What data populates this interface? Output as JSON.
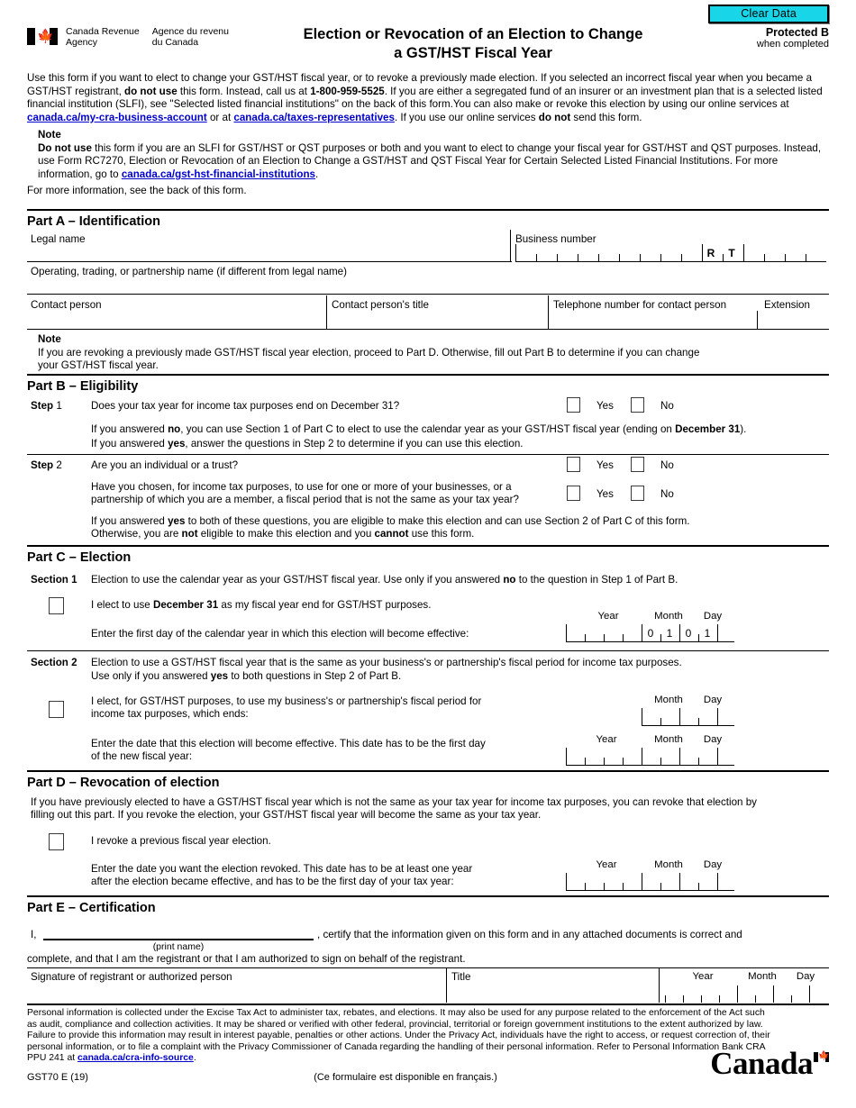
{
  "toolbar": {
    "clear_data_label": "Clear Data"
  },
  "header": {
    "agency_en": "Canada Revenue\nAgency",
    "agency_en_l1": "Canada Revenue",
    "agency_en_l2": "Agency",
    "agency_fr_l1": "Agence du revenu",
    "agency_fr_l2": "du Canada",
    "title_line1": "Election or Revocation of an Election to Change",
    "title_line2": "a GST/HST Fiscal Year",
    "protected_label": "Protected B",
    "protected_sub": "when completed"
  },
  "intro": {
    "p1_a": "Use this form if you want to elect to change your GST/HST fiscal year, or to revoke a previously made election. If you selected an incorrect fiscal year when you became a GST/HST registrant, ",
    "p1_b": "do not use",
    "p1_c": " this form. Instead, call us at ",
    "p1_d": "1-800-959-5525",
    "p1_e": ". If you are either a segregated fund of an insurer or an investment plan that is a selected listed financial institution (SLFI), see \"Selected listed financial institutions\" on the back of this form.You can also make or revoke this election by using our online services at ",
    "p1_link1": "canada.ca/my-cra-business-account",
    "p1_f": " or at ",
    "p1_link2": "canada.ca/taxes-representatives",
    "p1_g": ". If you use our online services ",
    "p1_h": "do not",
    "p1_i": " send this form."
  },
  "note1": {
    "label": "Note",
    "a": "Do not use",
    "b": " this form if you are an SLFI for GST/HST or QST purposes or both and you want to elect to change your fiscal year for GST/HST and QST purposes. Instead, use Form RC7270, Election or Revocation of an Election to Change a GST/HST and QST Fiscal Year for Certain Selected Listed Financial Institutions. For more information, go to ",
    "link": "canada.ca/gst-hst-financial-institutions",
    "c": ".",
    "more_info": "For more information, see the back of this form."
  },
  "partA": {
    "heading": "Part A – Identification",
    "legal_name_label": "Legal name",
    "business_number_label": "Business number",
    "bn_program_r": "R",
    "bn_program_t": "T",
    "operating_name_label": "Operating, trading, or partnership name (if different from legal name)",
    "contact_person_label": "Contact person",
    "contact_title_label": "Contact person's title",
    "telephone_label": "Telephone number for contact person",
    "extension_label": "Extension",
    "legal_name_value": "",
    "operating_name_value": "",
    "contact_person_value": "",
    "contact_title_value": "",
    "telephone_value": "",
    "extension_value": ""
  },
  "note2": {
    "label": "Note",
    "line1": "If you are revoking a previously made GST/HST fiscal year election, proceed to Part D. Otherwise, fill out Part B to determine if you can change",
    "line2": "your GST/HST fiscal year."
  },
  "partB": {
    "heading": "Part B – Eligibility",
    "step1_label_bold": "Step",
    "step1_label_num": " 1",
    "step1_question": "Does your tax year for income tax purposes end on December 31?",
    "yes_label": "Yes",
    "no_label": "No",
    "step1_note_a": "If you answered ",
    "step1_note_b": "no",
    "step1_note_c": ", you can use Section 1 of Part C to elect to use the calendar year as your GST/HST fiscal year (ending on ",
    "step1_note_d": "December 31",
    "step1_note_e": ").",
    "step1_note2_a": "If you answered ",
    "step1_note2_b": "yes",
    "step1_note2_c": ", answer the questions in Step 2 to determine if you can use this election.",
    "step2_label_bold": "Step",
    "step2_label_num": " 2",
    "step2_q1": "Are you an individual or a trust?",
    "step2_q2_line1": "Have you chosen, for income tax purposes, to use for one or more of your businesses, or a",
    "step2_q2_line2": "partnership of which you are a member, a fiscal period that is not the same as your tax year?",
    "step2_note_a": "If you answered ",
    "step2_note_b": "yes",
    "step2_note_c": " to both of these questions, you are eligible to make this election and can use Section 2 of Part C of this form.",
    "step2_note2_a": "Otherwise, you are ",
    "step2_note2_b": "not",
    "step2_note2_c": " eligible to make this election and you ",
    "step2_note2_d": "cannot",
    "step2_note2_e": " use this form."
  },
  "partC": {
    "heading": "Part C – Election",
    "section1_label": "Section 1",
    "section1_desc_a": "Election to use the calendar year as your GST/HST fiscal year. Use only if you answered ",
    "section1_desc_b": "no",
    "section1_desc_c": " to the question in Step 1 of Part B.",
    "section1_elect_a": "I elect to use ",
    "section1_elect_b": "December 31",
    "section1_elect_c": " as my fiscal year end for GST/HST purposes.",
    "section1_date_prompt": "Enter the first day of the calendar year in which this election will become effective:",
    "section2_label": "Section 2",
    "section2_desc_line1": "Election to use a GST/HST fiscal year that is the same as your business's or partnership's fiscal period for income tax purposes.",
    "section2_desc_line2_a": "Use only if you answered ",
    "section2_desc_line2_b": "yes",
    "section2_desc_line2_c": " to both questions in Step 2 of Part B.",
    "section2_elect_line1": "I elect, for GST/HST purposes, to use my business's or partnership's fiscal period for",
    "section2_elect_line2": "income tax purposes, which ends:",
    "section2_date_line1": "Enter the date that this election will become effective. This date has to be the first day",
    "section2_date_line2": "of the new fiscal year:"
  },
  "partD": {
    "heading": "Part D – Revocation of election",
    "desc_line1": "If you have previously elected to have a GST/HST fiscal year which is not the same as your tax year for income tax purposes, you can revoke that election by",
    "desc_line2": "filling out this part. If you revoke the election, your GST/HST fiscal year will become the same as your tax year.",
    "revoke_label": "I revoke a previous fiscal year election.",
    "date_line1": "Enter the date you want the election revoked. This date has to be at least one year",
    "date_line2": "after the election became effective, and has to be the first day of your tax year:"
  },
  "partE": {
    "heading": "Part E – Certification",
    "i_label": "I,",
    "print_name_label": "(print name)",
    "certify_text": ", certify that the information given on this form and in any attached documents is correct and",
    "complete_text": "complete, and that I am the registrant or that I am authorized to sign on behalf of the registrant.",
    "signature_label": "Signature of registrant or authorized person",
    "title_label": "Title",
    "print_name_value": "",
    "signature_value": "",
    "title_value": ""
  },
  "date_labels": {
    "year": "Year",
    "month": "Month",
    "day": "Day"
  },
  "prefilled": {
    "section1_month_d1": "0",
    "section1_month_d2": "1",
    "section1_day_d1": "0",
    "section1_day_d2": "1"
  },
  "footer": {
    "privacy_line1": "Personal information is collected under the Excise Tax Act to administer tax, rebates, and elections. It may also be used for any purpose related to the enforcement of the Act such",
    "privacy_line2": "as audit, compliance and collection activities. It may be shared or verified with other federal, provincial, territorial or foreign government institutions to the extent authorized by law.",
    "privacy_line3": "Failure to provide this information may result in interest payable, penalties or other actions. Under the Privacy Act, individuals have the right to access, or request correction of, their",
    "privacy_line4": "personal information, or to file a complaint with the Privacy Commissioner of Canada regarding the handling of their personal information. Refer to Personal Information Bank CRA",
    "privacy_line5_a": "PPU 241 at ",
    "privacy_link": "canada.ca/cra-info-source",
    "privacy_line5_b": ".",
    "form_id": "GST70 E (19)",
    "french_note": "(Ce formulaire est disponible en français.)",
    "wordmark": "Canada"
  },
  "colors": {
    "clear_data_bg": "#18D5E8",
    "link": "#0000CC",
    "rule": "#000000"
  }
}
